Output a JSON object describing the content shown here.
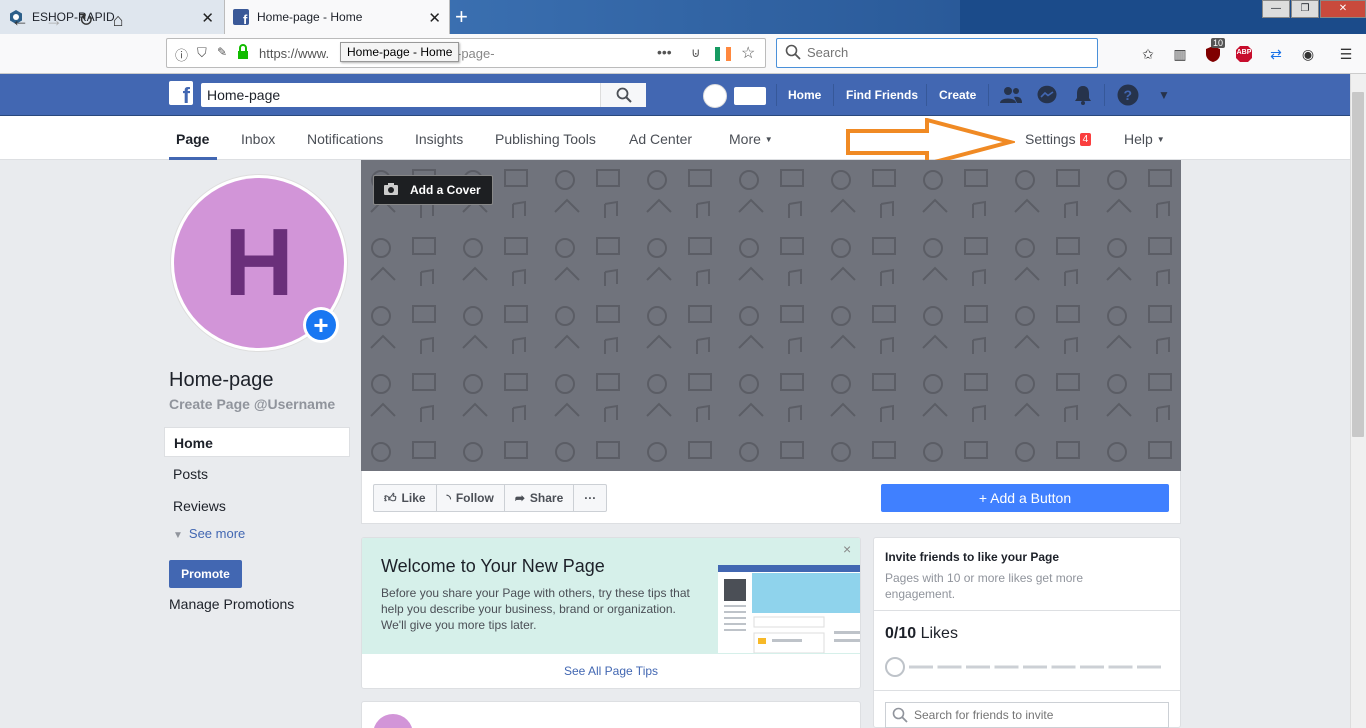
{
  "browser": {
    "tabs": [
      {
        "title": "ESHOP-RAPID"
      },
      {
        "title": "Home-page - Home"
      }
    ],
    "url_visible_start": "https://www.",
    "url_visible_end": "-page-",
    "tooltip": "Home-page - Home",
    "search_placeholder": "Search",
    "notification_count": "10",
    "abp_label": "ABP"
  },
  "fb_header": {
    "search_value": "Home-page",
    "nav": {
      "home": "Home",
      "find_friends": "Find Friends",
      "create": "Create"
    }
  },
  "page_nav": {
    "items": [
      "Page",
      "Inbox",
      "Notifications",
      "Insights",
      "Publishing Tools",
      "Ad Center",
      "More"
    ],
    "settings": "Settings",
    "settings_badge": "4",
    "help": "Help"
  },
  "sidebar": {
    "avatar_letter": "H",
    "page_name": "Home-page",
    "username_cta": "Create Page @Username",
    "items": [
      "Home",
      "Posts",
      "Reviews"
    ],
    "see_more": "See more",
    "promote": "Promote",
    "manage_promotions": "Manage Promotions"
  },
  "cover": {
    "add_cover": "Add a Cover"
  },
  "actions": {
    "like": "Like",
    "follow": "Follow",
    "share": "Share",
    "more": "···",
    "add_button": "Add a Button"
  },
  "welcome": {
    "title": "Welcome to Your New Page",
    "body": "Before you share your Page with others, try these tips that help you describe your business, brand or organization. We'll give you more tips later.",
    "see_all": "See All Page Tips",
    "close": "×"
  },
  "invite": {
    "title": "Invite friends to like your Page",
    "subtitle": "Pages with 10 or more likes get more engagement.",
    "likes_value": "0/10",
    "likes_label": "Likes",
    "likes_progress": 0,
    "search_placeholder": "Search for friends to invite"
  },
  "colors": {
    "fb_blue": "#4267b2",
    "accent_orange": "#f08a24",
    "avatar": "#d295d8"
  }
}
